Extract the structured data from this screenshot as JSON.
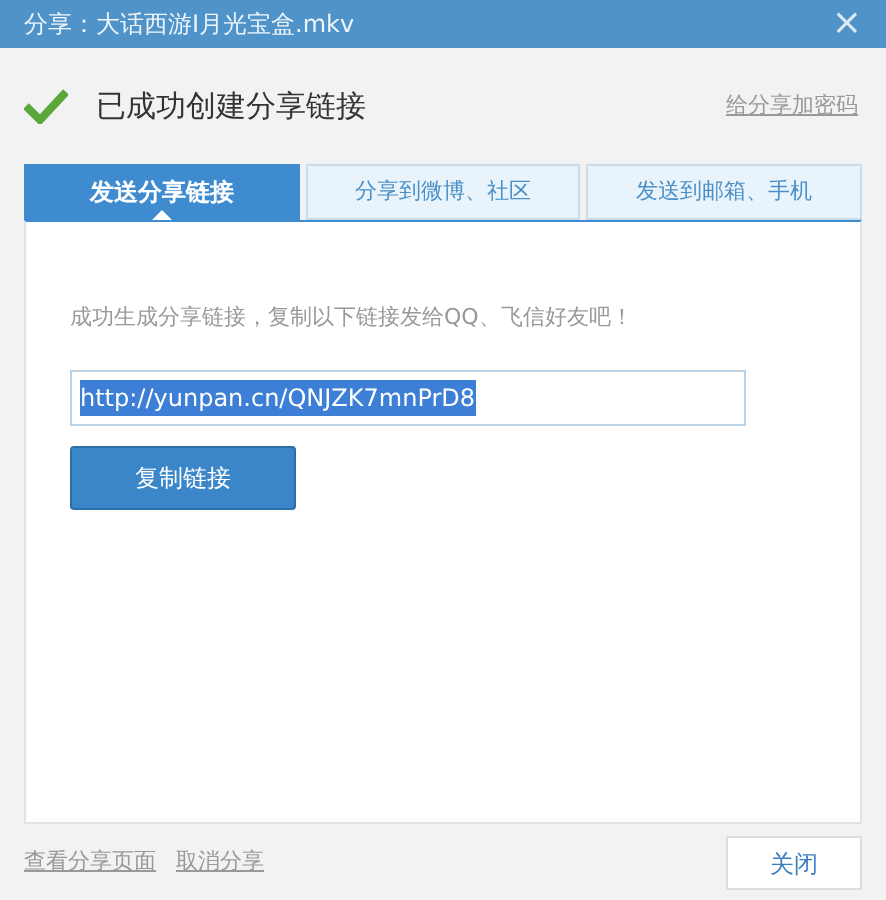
{
  "window": {
    "title": "分享：大话西游Ⅰ月光宝盒.mkv",
    "close": "×"
  },
  "header": {
    "message": "已成功创建分享链接",
    "password_link": "给分享加密码"
  },
  "tabs": [
    {
      "label": "发送分享链接",
      "selected": true
    },
    {
      "label": "分享到微博、社区",
      "selected": false
    },
    {
      "label": "发送到邮箱、手机",
      "selected": false
    }
  ],
  "panel": {
    "instruction": "成功生成分享链接，复制以下链接发给QQ、飞信好友吧！",
    "link_field": {
      "value": "http://yunpan.cn/QNJZK7mnPrD8",
      "text_selected": true
    },
    "copy_button": "复制链接"
  },
  "footer": {
    "links": [
      "查看分享页面",
      "取消分享"
    ],
    "close_button": "关闭"
  }
}
